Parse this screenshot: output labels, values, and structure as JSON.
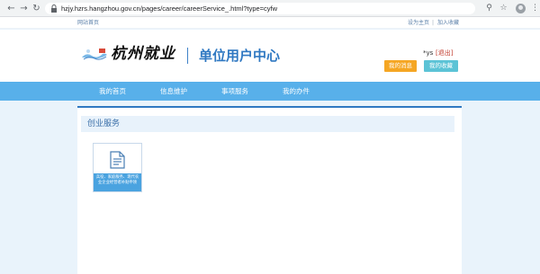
{
  "browser": {
    "url": "hzjy.hzrs.hangzhou.gov.cn/pages/career/careerService_.html?type=cyfw"
  },
  "top_links": {
    "home": "网站首页",
    "set_homepage": "设为主页",
    "bookmark": "加入收藏",
    "separator": "|"
  },
  "header": {
    "logo_text": "杭州就业",
    "center_title": "单位用户中心",
    "user_name": "*ys",
    "logout": "[退出]",
    "my_messages": "我的消息",
    "my_favorites": "我的收藏"
  },
  "nav": {
    "items": [
      {
        "label": "我的首页"
      },
      {
        "label": "信息维护"
      },
      {
        "label": "事项服务"
      },
      {
        "label": "我的办件"
      }
    ]
  },
  "main": {
    "section_title": "创业服务",
    "card_label": "兵役、家庭服务、现代农业企业经营者补贴申领"
  },
  "colors": {
    "nav_bg": "#58b0ea",
    "accent": "#2f78c2",
    "msg_btn": "#f5a623",
    "fav_btn": "#5cc3d6"
  }
}
